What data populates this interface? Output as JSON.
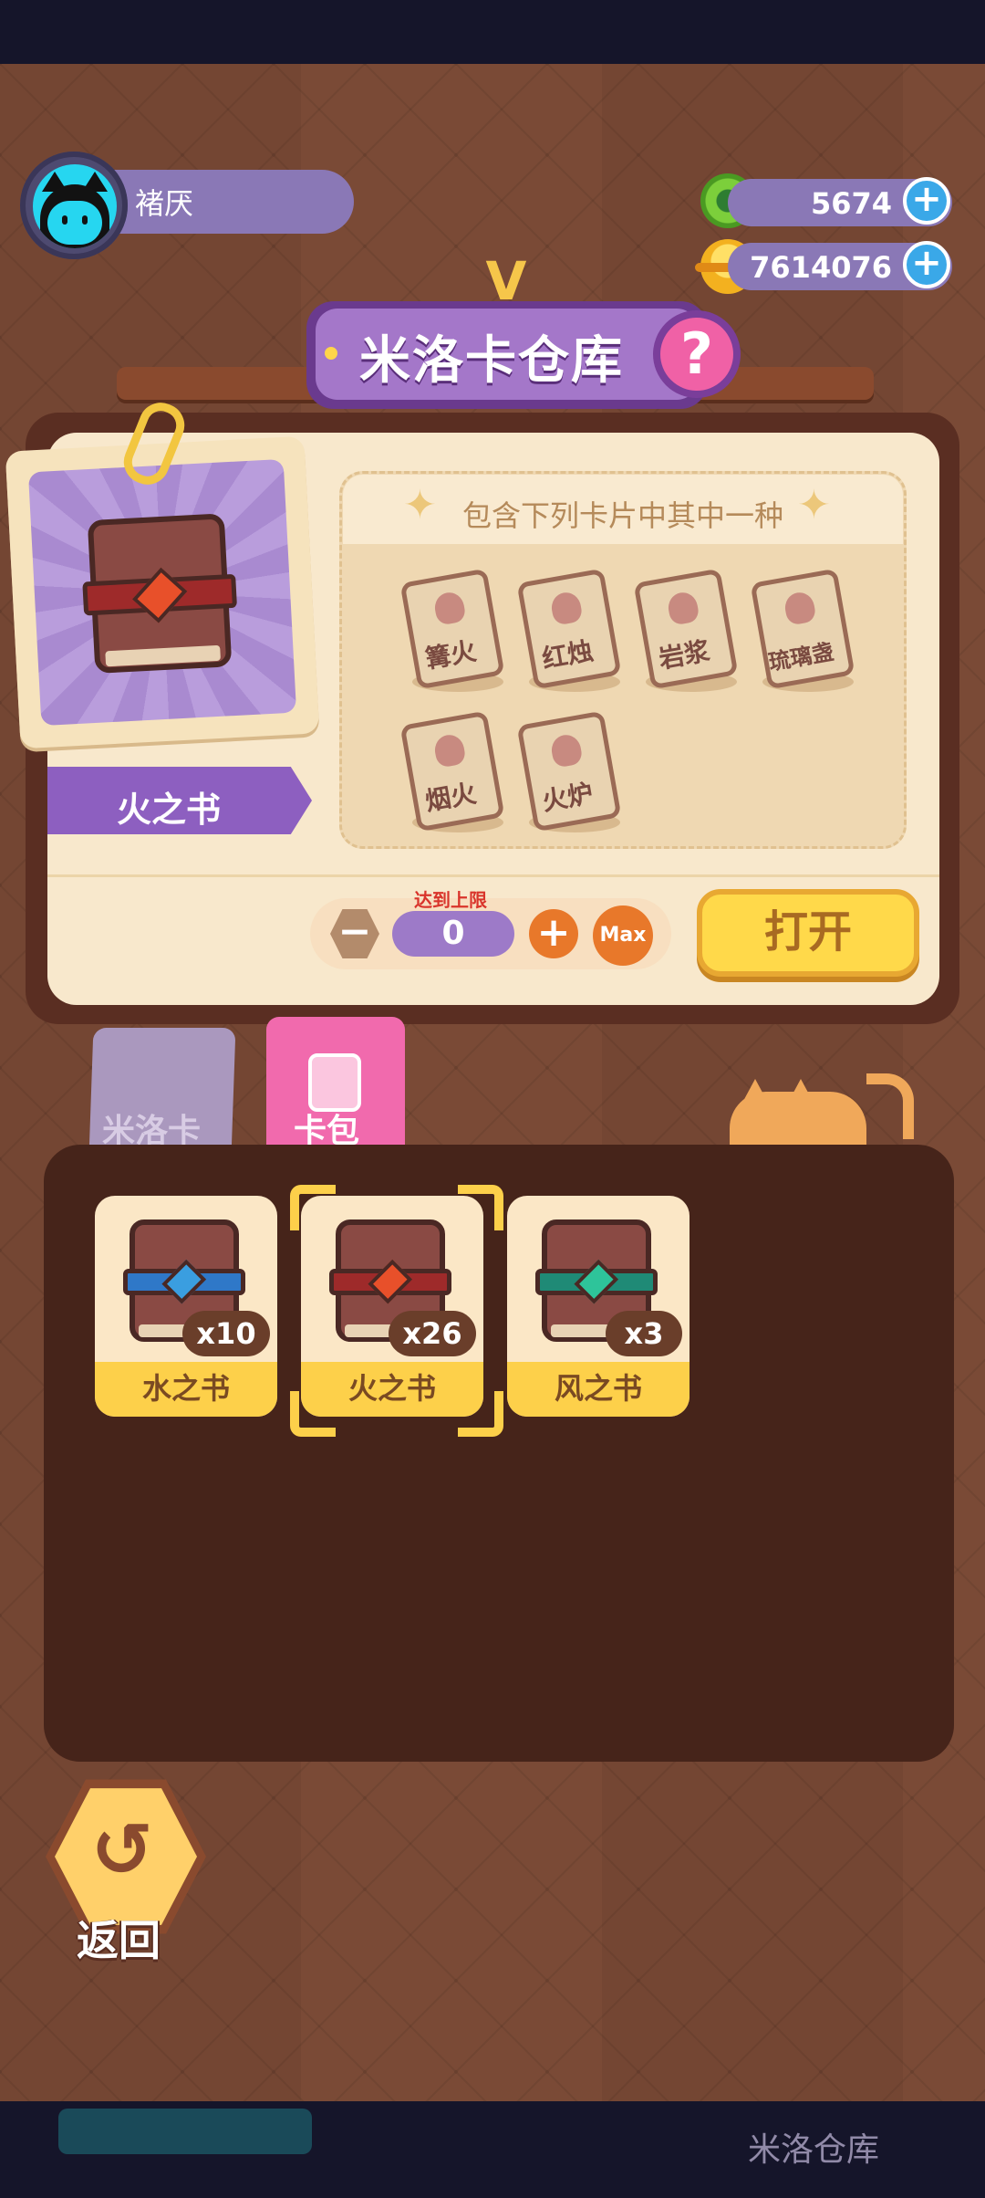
{
  "profile": {
    "username": "褚厌"
  },
  "currency": [
    {
      "name": "green-currency",
      "value": "5674",
      "icon": "green-ring-icon"
    },
    {
      "name": "gold-currency",
      "value": "7614076",
      "icon": "planet-coin-icon"
    }
  ],
  "title": {
    "text": "米洛卡仓库",
    "help": "?",
    "badge": "V"
  },
  "selected_pack": {
    "name": "火之书",
    "contents_header": "包含下列卡片中其中一种",
    "cards": [
      "篝火",
      "红烛",
      "岩浆",
      "琉璃盏",
      "烟火",
      "火炉"
    ]
  },
  "controls": {
    "limit_text": "达到上限",
    "quantity": "0",
    "minus": "−",
    "plus": "+",
    "max": "Max",
    "open": "打开"
  },
  "tabs": [
    {
      "label": "米洛卡",
      "active": false
    },
    {
      "label": "卡包",
      "active": true
    }
  ],
  "inventory": [
    {
      "name": "水之书",
      "count": "x10",
      "gem_color": "#3a9ee0",
      "strap_color": "#2f78c8"
    },
    {
      "name": "火之书",
      "count": "x26",
      "gem_color": "#e8502a",
      "strap_color": "#9e2a2a",
      "selected": true
    },
    {
      "name": "风之书",
      "count": "x3",
      "gem_color": "#2ec49a",
      "strap_color": "#1f8a76"
    }
  ],
  "back": {
    "label": "返回"
  },
  "bottom_nav": {
    "ghost_label": "米洛仓库"
  },
  "colors": {
    "purple": "#a477c9",
    "brown": "#46241a",
    "gold": "#fdd04a",
    "pink": "#f16aad"
  }
}
